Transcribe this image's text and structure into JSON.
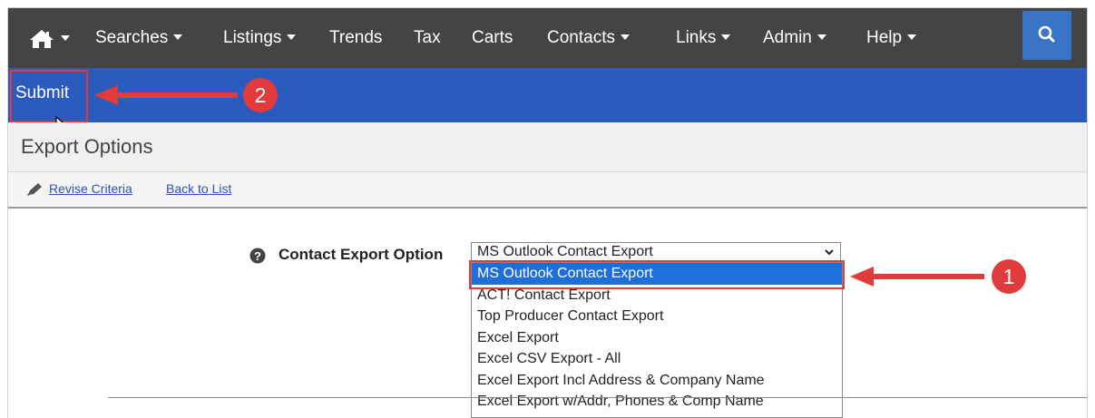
{
  "nav": {
    "items": [
      {
        "label": "Searches",
        "has_caret": true
      },
      {
        "label": "Listings",
        "has_caret": true
      },
      {
        "label": "Trends",
        "has_caret": false
      },
      {
        "label": "Tax",
        "has_caret": false
      },
      {
        "label": "Carts",
        "has_caret": false
      },
      {
        "label": "Contacts",
        "has_caret": true
      },
      {
        "label": "Links",
        "has_caret": true
      },
      {
        "label": "Admin",
        "has_caret": true
      },
      {
        "label": "Help",
        "has_caret": true
      }
    ],
    "home_icon": "home-icon",
    "search_icon": "search-icon"
  },
  "toolbar": {
    "submit_label": "Submit"
  },
  "page": {
    "title": "Export Options"
  },
  "links": {
    "revise": "Revise Criteria",
    "back": "Back to List"
  },
  "form": {
    "label": "Contact Export Option",
    "selected": "MS Outlook Contact Export",
    "options": [
      "MS Outlook Contact Export",
      "ACT! Contact Export",
      "Top Producer Contact Export",
      "Excel Export",
      "Excel CSV Export - All",
      "Excel Export Incl Address & Company Name",
      "Excel Export w/Addr, Phones & Comp Name"
    ]
  },
  "annotations": {
    "step1": "1",
    "step2": "2"
  },
  "colors": {
    "nav_bg": "#444444",
    "toolbar_bg": "#2b5bbd",
    "highlight": "#e03a3a",
    "selected_option": "#1e6fd9"
  }
}
